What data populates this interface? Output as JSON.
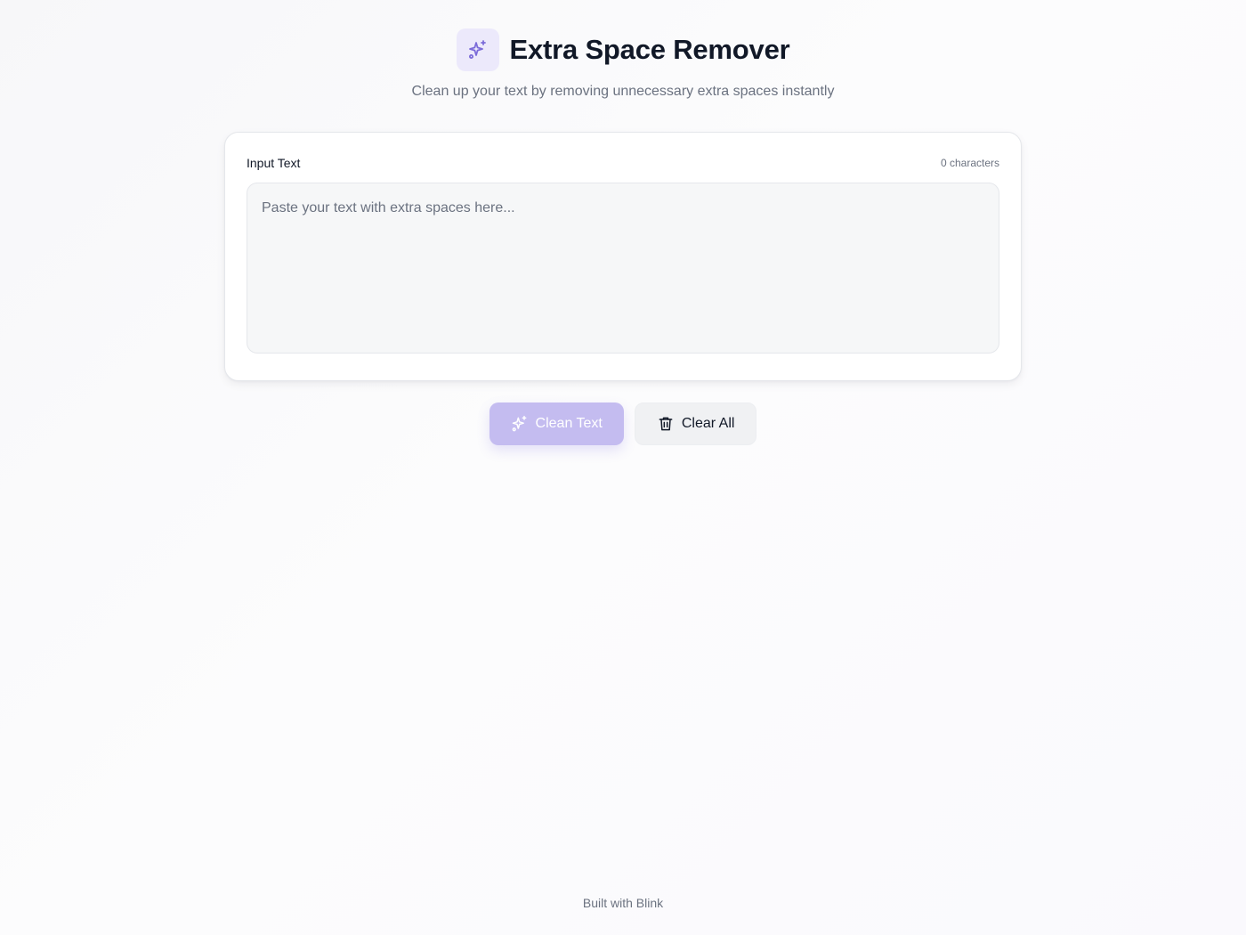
{
  "app": {
    "title": "Extra Space Remover",
    "subtitle": "Clean up your text by removing unnecessary extra spaces instantly",
    "logo_icon": "sparkles-icon"
  },
  "input": {
    "label": "Input Text",
    "char_count": "0 characters",
    "value": "",
    "placeholder": "Paste your text with extra spaces here..."
  },
  "actions": {
    "clean_label": "Clean Text",
    "clean_icon": "sparkles-icon",
    "clean_disabled": true,
    "clear_label": "Clear All",
    "clear_icon": "trash-icon"
  },
  "footer": {
    "text": "Built with Blink"
  },
  "colors": {
    "accent": "#7c6cd9",
    "accent_light": "#ece9fb",
    "primary_button_disabled": "#c4bcf0",
    "text_primary": "#111827",
    "text_muted": "#6b7280"
  }
}
